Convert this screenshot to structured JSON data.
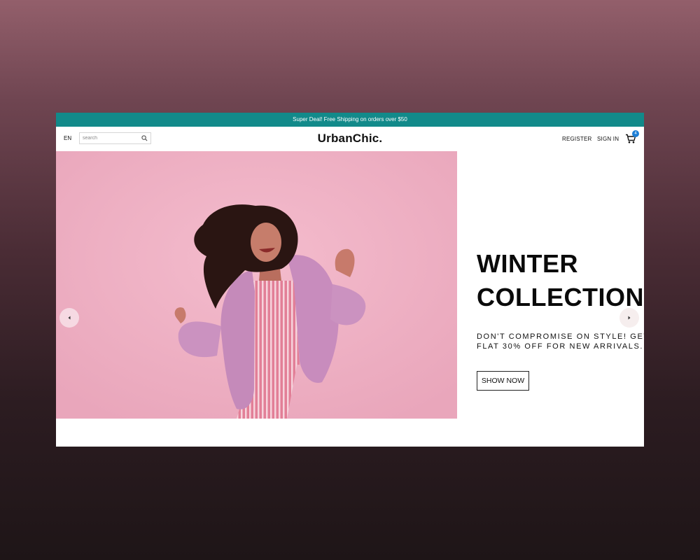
{
  "promo": {
    "text": "Super Deal! Free Shipping on orders over $50"
  },
  "header": {
    "language": "EN",
    "search_placeholder": "search",
    "logo": "UrbanChic.",
    "register_label": "REGISTER",
    "signin_label": "SIGN IN",
    "cart_count": "4"
  },
  "hero": {
    "title_line1": "WINTER",
    "title_line2": "COLLECTION",
    "subtitle_line1": "DON'T COMPROMISE ON STYLE! GET",
    "subtitle_line2": "FLAT 30% OFF FOR NEW ARRIVALS.",
    "cta_label": "SHOW NOW"
  },
  "colors": {
    "promo_bar": "#128a8a",
    "cart_badge": "#1e7fd6",
    "hero_background": "#efb2c6"
  },
  "icons": {
    "search": "search-icon",
    "cart": "cart-icon",
    "prev": "chevron-left-icon",
    "next": "chevron-right-icon"
  }
}
